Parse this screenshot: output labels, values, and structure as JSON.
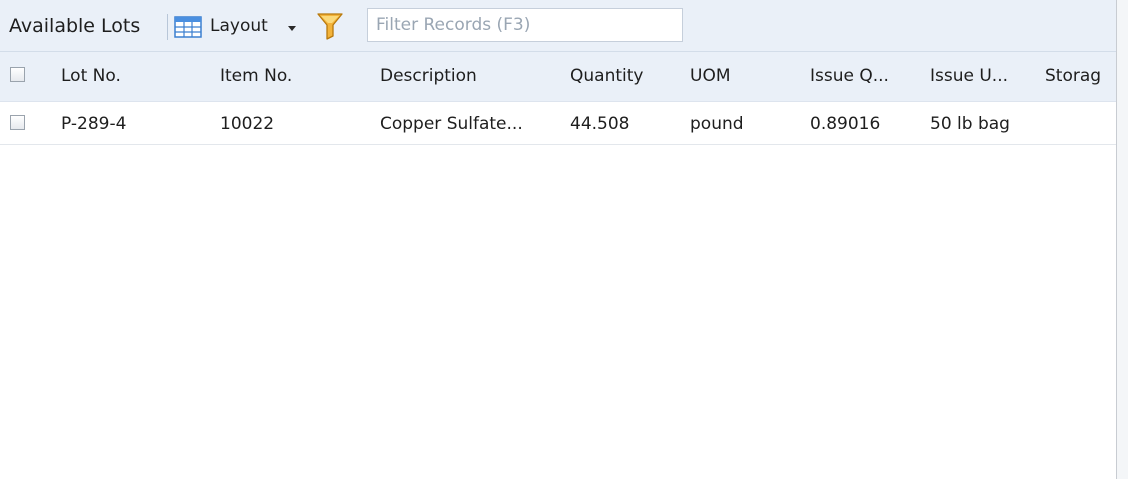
{
  "toolbar": {
    "title": "Available Lots",
    "layout_label": "Layout",
    "layout_icon": "table-layout-icon",
    "filter_icon": "funnel-icon",
    "filter_placeholder": "Filter Records (F3)"
  },
  "grid": {
    "columns": [
      "Lot No.",
      "Item No.",
      "Description",
      "Quantity",
      "UOM",
      "Issue Q...",
      "Issue U...",
      "Storag"
    ],
    "rows": [
      {
        "lot_no": "P-289-4",
        "item_no": "10022",
        "description": "Copper Sulfate...",
        "quantity": "44.508",
        "uom": "pound",
        "issue_qty": "0.89016",
        "issue_uom": "50 lb bag",
        "storage": "",
        "selected": false
      }
    ]
  },
  "colors": {
    "toolbar_bg": "#eaf0f8",
    "header_bg": "#eaf0f8",
    "funnel_accent": "#f0a81c"
  }
}
